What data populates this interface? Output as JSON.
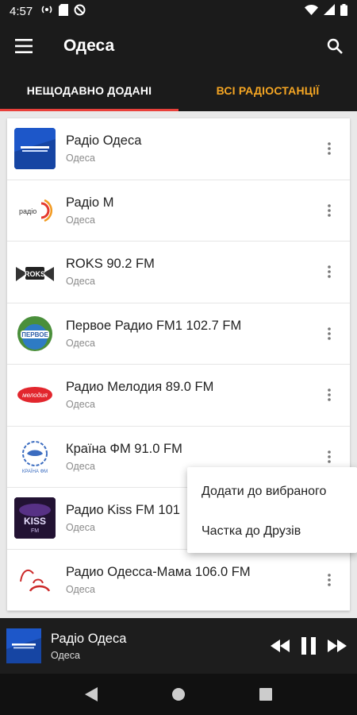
{
  "status_bar": {
    "time": "4:57",
    "icons": [
      "radio-signal-icon",
      "sd-card-icon",
      "no-sync-icon",
      "wifi-icon",
      "cell-signal-icon",
      "battery-icon"
    ]
  },
  "app_bar": {
    "title": "Одеса",
    "menu_icon": "hamburger-menu-icon",
    "search_icon": "search-icon"
  },
  "tabs": [
    {
      "label": "НЕЩОДАВНО ДОДАНІ",
      "active": true
    },
    {
      "label": "ВСІ РАДІОСТАНЦІЇ",
      "active": false
    }
  ],
  "colors": {
    "accent_tab": "#f5a623",
    "indicator": "#e8403a",
    "bar_bg": "#1b1b1b"
  },
  "stations": [
    {
      "name": "Радіо Одеса",
      "city": "Одеса",
      "logo": "radio-odesa-logo"
    },
    {
      "name": "Радіо М",
      "city": "Одеса",
      "logo": "radio-m-logo"
    },
    {
      "name": "ROKS 90.2 FM",
      "city": "Одеса",
      "logo": "roks-logo"
    },
    {
      "name": "Первое Радио FM1 102.7 FM",
      "city": "Одеса",
      "logo": "pervoe-radio-logo"
    },
    {
      "name": "Радио Мелодия 89.0 FM",
      "city": "Одеса",
      "logo": "melodia-logo"
    },
    {
      "name": "Країна ФМ 91.0 FM",
      "city": "Одеса",
      "logo": "kraina-fm-logo"
    },
    {
      "name": "Радио Kiss FM 101",
      "city": "Одеса",
      "logo": "kiss-fm-logo"
    },
    {
      "name": "Радио Одесса-Мама 106.0 FM",
      "city": "Одеса",
      "logo": "odessa-mama-logo"
    }
  ],
  "context_menu": {
    "items": [
      "Додати до вибраного",
      "Частка до Друзів"
    ]
  },
  "player": {
    "title": "Радіо Одеса",
    "subtitle": "Одеса",
    "state": "playing"
  },
  "nav_bar": {
    "icons": [
      "back-icon",
      "home-icon",
      "recents-icon"
    ]
  }
}
